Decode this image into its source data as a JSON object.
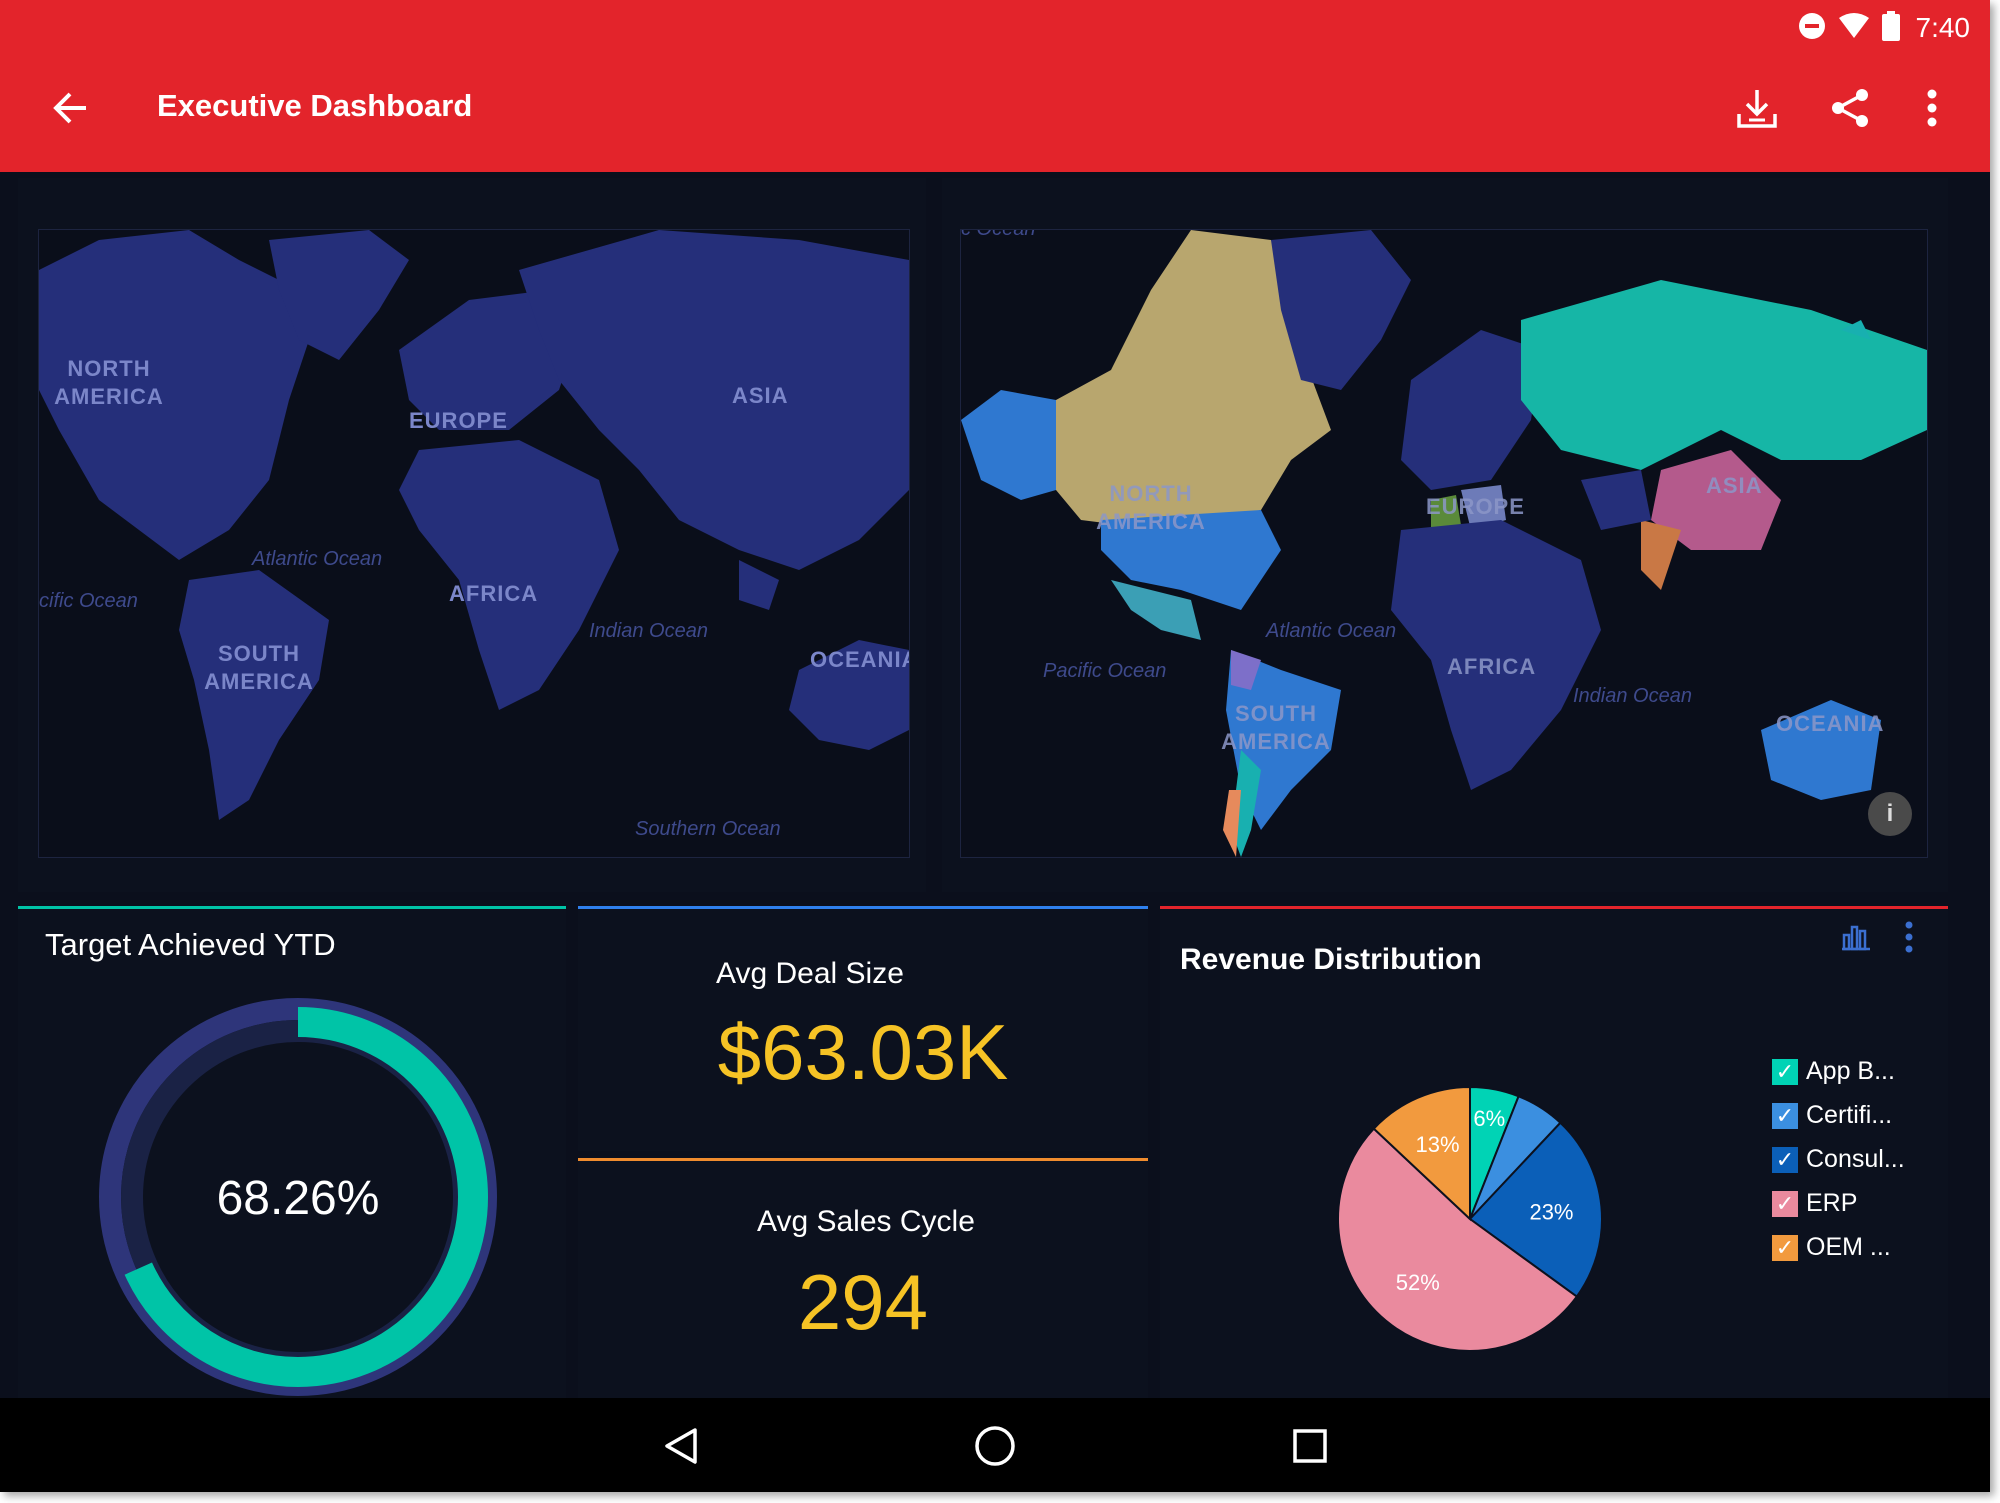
{
  "status_bar": {
    "time": "7:40",
    "icons": [
      "dnd-icon",
      "wifi-icon",
      "battery-icon"
    ]
  },
  "app_bar": {
    "title": "Executive Dashboard",
    "back_icon": "arrow-back-icon",
    "actions": [
      "download-icon",
      "share-icon",
      "more-vert-icon"
    ]
  },
  "map_left": {
    "continents": {
      "north_america": "NORTH\nAMERICA",
      "europe": "EUROPE",
      "asia": "ASIA",
      "africa": "AFRICA",
      "south_america": "SOUTH\nAMERICA",
      "oceania": "OCEANIA"
    },
    "oceans": {
      "atlantic": "Atlantic Ocean",
      "pacific": "cific Ocean",
      "indian": "Indian Ocean",
      "southern": "Southern Ocean"
    }
  },
  "map_right": {
    "continents": {
      "north_america": "NORTH\nAMERICA",
      "europe": "EUROPE",
      "asia": "ASIA",
      "africa": "AFRICA",
      "south_america": "SOUTH\nAMERICA",
      "oceania": "OCEANIA"
    },
    "oceans": {
      "top": "c Ocean",
      "atlantic": "Atlantic Ocean",
      "pacific": "Pacific Ocean",
      "indian": "Indian Ocean"
    },
    "info_icon": "info-icon"
  },
  "target": {
    "title": "Target Achieved YTD",
    "value_label": "68.26%",
    "value": 0.6826,
    "accent": "#00c4a7",
    "track": "#2e357a"
  },
  "avg_deal": {
    "title": "Avg Deal Size",
    "value": "$63.03K",
    "accent": "#2f80ed"
  },
  "avg_cycle": {
    "title": "Avg Sales Cycle",
    "value": "294",
    "accent": "#f08c2e"
  },
  "revenue": {
    "title": "Revenue Distribution",
    "accent": "#e3242b",
    "toolbar_icons": [
      "bar-chart-icon",
      "more-vert-icon"
    ],
    "legend": [
      {
        "label": "App B...",
        "color": "#00d3b5"
      },
      {
        "label": "Certifi...",
        "color": "#3b8fe0"
      },
      {
        "label": "Consul...",
        "color": "#0b5fb8"
      },
      {
        "label": "ERP",
        "color": "#ea8a9e"
      },
      {
        "label": "OEM ...",
        "color": "#f29a3e"
      }
    ]
  },
  "chart_data": {
    "type": "pie",
    "title": "Revenue Distribution",
    "categories": [
      "App B...",
      "Certifi...",
      "Consul...",
      "ERP",
      "OEM ..."
    ],
    "values": [
      6,
      6,
      23,
      52,
      13
    ],
    "data_labels": [
      "6%",
      "",
      "23%",
      "52%",
      "13%"
    ],
    "colors": [
      "#00d3b5",
      "#3b8fe0",
      "#0b5fb8",
      "#ea8a9e",
      "#f29a3e"
    ],
    "legend_position": "right"
  },
  "nav_bar": {
    "icons": [
      "back-triangle-icon",
      "home-circle-icon",
      "recents-square-icon"
    ]
  }
}
